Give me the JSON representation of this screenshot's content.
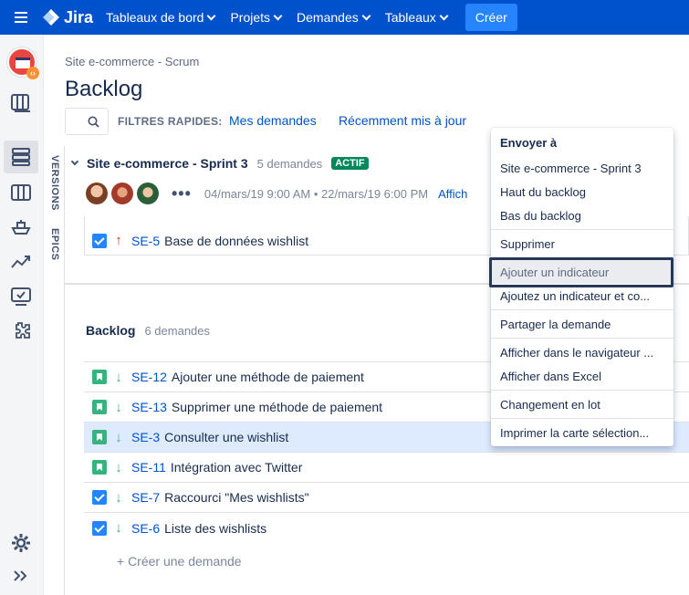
{
  "topnav": {
    "brand": "Jira",
    "items": [
      {
        "label": "Tableaux de bord"
      },
      {
        "label": "Projets"
      },
      {
        "label": "Demandes"
      },
      {
        "label": "Tableaux"
      }
    ],
    "create_label": "Créer",
    "colors": {
      "bar": "#0052cc",
      "create": "#2684ff"
    }
  },
  "sidebar": {
    "icons": [
      "project-avatar",
      "board-icon",
      "backlog-icon",
      "columns-icon",
      "ship-icon",
      "reports-icon",
      "releases-icon",
      "addon-icon",
      "settings-icon",
      "expand-icon"
    ]
  },
  "header": {
    "breadcrumb": "Site e-commerce - Scrum",
    "title": "Backlog",
    "quick_filters_label": "FILTRES RAPIDES:",
    "quick_filters": [
      "Mes demandes",
      "Récemment mis à jour"
    ]
  },
  "vertical_tabs": [
    "VERSIONS",
    "EPICS"
  ],
  "sprint": {
    "name": "Site e-commerce - Sprint 3",
    "count": "5 demandes",
    "status": "ACTIF",
    "dots": "•••",
    "dates": "04/mars/19 9:00 AM • 22/mars/19 6:00 PM",
    "link": "Affich",
    "issues": [
      {
        "key": "SE-5",
        "summary": "Base de données wishlist",
        "type": "task",
        "priority": "high"
      }
    ]
  },
  "backlog": {
    "title": "Backlog",
    "count": "6 demandes",
    "issues": [
      {
        "key": "SE-12",
        "summary": "Ajouter une méthode de paiement",
        "type": "story",
        "priority": "low"
      },
      {
        "key": "SE-13",
        "summary": "Supprimer une méthode de paiement",
        "type": "story",
        "priority": "low"
      },
      {
        "key": "SE-3",
        "summary": "Consulter une wishlist",
        "type": "story",
        "priority": "low",
        "selected": true
      },
      {
        "key": "SE-11",
        "summary": "Intégration avec Twitter",
        "type": "story",
        "priority": "low"
      },
      {
        "key": "SE-7",
        "summary": "Raccourci \"Mes wishlists\"",
        "type": "task",
        "priority": "low"
      },
      {
        "key": "SE-6",
        "summary": "Liste des wishlists",
        "type": "task",
        "priority": "low"
      }
    ],
    "create_label": "+ Créer une demande"
  },
  "context_menu": {
    "heading": "Envoyer à",
    "items": [
      "Site e-commerce - Sprint 3",
      "Haut du backlog",
      "Bas du backlog",
      "Supprimer",
      "Ajouter un indicateur",
      "Ajoutez un indicateur et co...",
      "Partager la demande",
      "Afficher dans le navigateur ...",
      "Afficher dans Excel",
      "Changement en lot",
      "Imprimer la carte sélection..."
    ],
    "highlighted": "Ajouter un indicateur"
  }
}
